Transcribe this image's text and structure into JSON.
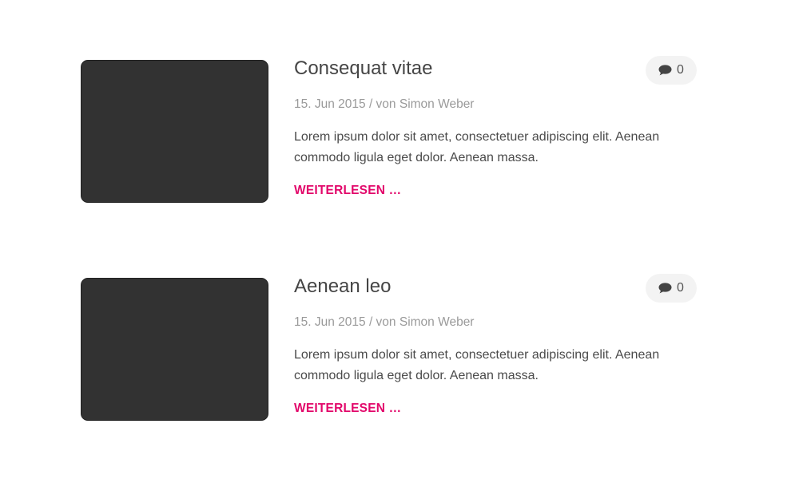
{
  "posts": [
    {
      "title": "Consequat vitae",
      "date": "15. Jun 2015",
      "separator": " / von ",
      "author": "Simon Weber",
      "excerpt": "Lorem ipsum dolor sit amet, consectetuer adipiscing elit. Aenean commodo ligula eget dolor. Aenean massa.",
      "read_more": "WEITERLESEN …",
      "comment_count": "0",
      "comment_icon": "speech-bubble-icon"
    },
    {
      "title": "Aenean leo",
      "date": "15. Jun 2015",
      "separator": " / von ",
      "author": "Simon Weber",
      "excerpt": "Lorem ipsum dolor sit amet, consectetuer adipiscing elit. Aenean commodo ligula eget dolor. Aenean massa.",
      "read_more": "WEITERLESEN …",
      "comment_count": "0",
      "comment_icon": "speech-bubble-icon"
    }
  ],
  "colors": {
    "accent": "#e2076a",
    "thumbnail": "#323232",
    "meta": "#9a9a9a",
    "text": "#4a4a4a",
    "badge_bg": "#f3f3f3"
  }
}
